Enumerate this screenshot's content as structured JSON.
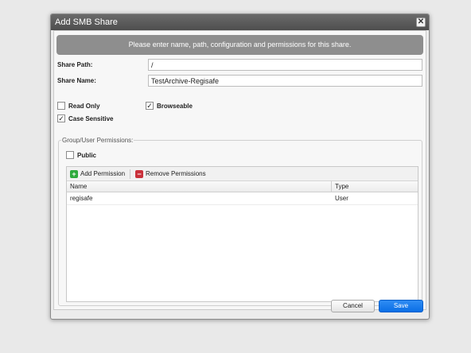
{
  "dialog": {
    "title": "Add SMB Share",
    "close_glyph": "✕",
    "banner": "Please enter name, path, configuration and permissions for this share."
  },
  "form": {
    "share_path_label": "Share Path:",
    "share_path_value": "/",
    "share_name_label": "Share Name:",
    "share_name_value": "TestArchive-Regisafe"
  },
  "options": {
    "read_only": {
      "label": "Read Only",
      "checked": false
    },
    "browseable": {
      "label": "Browseable",
      "checked": true
    },
    "case_sensitive": {
      "label": "Case Sensitive",
      "checked": true
    }
  },
  "permissions": {
    "legend": "Group/User Permissions:",
    "public": {
      "label": "Public",
      "checked": false
    },
    "add_label": "Add Permission",
    "remove_label": "Remove Permissions",
    "add_icon": "plus-icon",
    "remove_icon": "minus-icon",
    "columns": [
      "Name",
      "Type"
    ],
    "rows": [
      {
        "name": "regisafe",
        "type": "User"
      }
    ]
  },
  "buttons": {
    "cancel": "Cancel",
    "save": "Save"
  },
  "colors": {
    "save_button": "#0a6fe6",
    "add_icon": "#2eaa3c",
    "remove_icon": "#c9303a",
    "banner": "#8e8e8e"
  }
}
